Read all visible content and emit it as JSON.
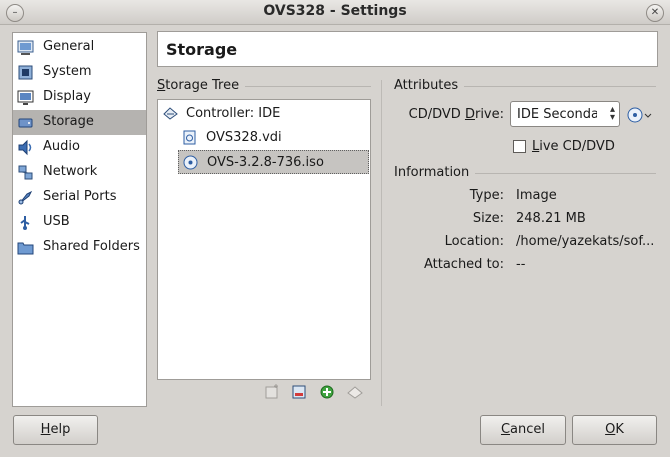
{
  "window": {
    "title": "OVS328 - Settings"
  },
  "sidebar": {
    "items": [
      {
        "label": "General",
        "icon": "general-icon",
        "selected": false
      },
      {
        "label": "System",
        "icon": "system-icon",
        "selected": false
      },
      {
        "label": "Display",
        "icon": "display-icon",
        "selected": false
      },
      {
        "label": "Storage",
        "icon": "storage-icon",
        "selected": true
      },
      {
        "label": "Audio",
        "icon": "audio-icon",
        "selected": false
      },
      {
        "label": "Network",
        "icon": "network-icon",
        "selected": false
      },
      {
        "label": "Serial Ports",
        "icon": "serial-ports-icon",
        "selected": false
      },
      {
        "label": "USB",
        "icon": "usb-icon",
        "selected": false
      },
      {
        "label": "Shared Folders",
        "icon": "shared-folders-icon",
        "selected": false
      }
    ]
  },
  "page": {
    "title": "Storage"
  },
  "storage_tree": {
    "heading": "Storage Tree",
    "controller": "Controller: IDE",
    "items": [
      {
        "label": "OVS328.vdi",
        "icon": "hard-disk-icon",
        "selected": false
      },
      {
        "label": "OVS-3.2.8-736.iso",
        "icon": "optical-disc-icon",
        "selected": true
      }
    ],
    "toolbar": [
      "add-controller-icon",
      "remove-controller-icon",
      "add-attachment-icon",
      "remove-attachment-icon"
    ]
  },
  "attributes": {
    "heading": "Attributes",
    "drive_label": "CD/DVD Drive:",
    "drive_value": "IDE Secondary Master",
    "live_cd_label": "Live CD/DVD",
    "live_cd_checked": false
  },
  "information": {
    "heading": "Information",
    "rows": [
      {
        "label": "Type:",
        "value": "Image"
      },
      {
        "label": "Size:",
        "value": "248.21 MB"
      },
      {
        "label": "Location:",
        "value": "/home/yazekats/sof..."
      },
      {
        "label": "Attached to:",
        "value": "--"
      }
    ]
  },
  "buttons": {
    "help": "Help",
    "cancel": "Cancel",
    "ok": "OK"
  },
  "colors": {
    "selected_bg": "#b5b3b0",
    "window_bg": "#d6d3cf"
  }
}
